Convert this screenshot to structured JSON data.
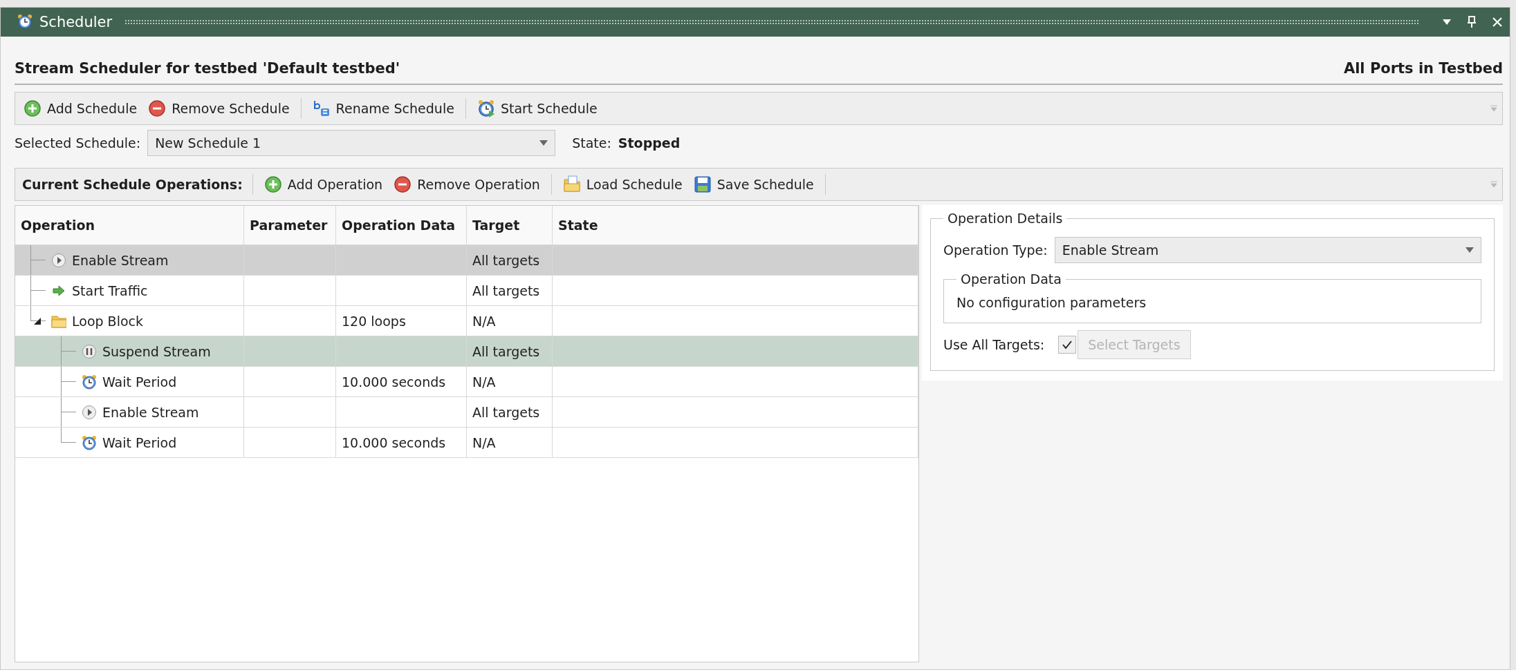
{
  "window": {
    "title": "Scheduler"
  },
  "header": {
    "title": "Stream Scheduler for testbed 'Default testbed'",
    "scope": "All Ports in Testbed"
  },
  "schedule_toolbar": {
    "groups": [
      [
        {
          "kind": "add",
          "label": "Add Schedule"
        },
        {
          "kind": "remove",
          "label": "Remove Schedule"
        }
      ],
      [
        {
          "kind": "rename",
          "label": "Rename Schedule"
        }
      ],
      [
        {
          "kind": "start",
          "label": "Start Schedule"
        }
      ]
    ]
  },
  "selected_schedule": {
    "label": "Selected Schedule:",
    "value": "New Schedule 1",
    "state_label": "State:",
    "state": "Stopped"
  },
  "operations_toolbar": {
    "label": "Current Schedule Operations:",
    "groups": [
      [
        {
          "kind": "add",
          "label": "Add Operation"
        },
        {
          "kind": "remove",
          "label": "Remove Operation"
        }
      ],
      [
        {
          "kind": "load",
          "label": "Load Schedule"
        },
        {
          "kind": "save",
          "label": "Save Schedule"
        }
      ]
    ]
  },
  "table": {
    "columns": [
      "Operation",
      "Parameter",
      "Operation Data",
      "Target",
      "State"
    ],
    "rows": [
      {
        "kind": "enable",
        "operation": "Enable Stream",
        "target": "All targets",
        "selected": true,
        "hovered": false
      },
      {
        "kind": "traffic",
        "operation": "Start Traffic",
        "target": "All targets",
        "selected": false,
        "hovered": false
      },
      {
        "kind": "loop",
        "operation": "Loop Block",
        "data": "120 loops",
        "target": "N/A",
        "selected": false,
        "hovered": false,
        "expanded": true,
        "children": [
          {
            "kind": "suspend",
            "operation": "Suspend Stream",
            "target": "All targets",
            "selected": false,
            "hovered": true
          },
          {
            "kind": "wait",
            "operation": "Wait Period",
            "data": "10.000 seconds",
            "target": "N/A",
            "selected": false,
            "hovered": false
          },
          {
            "kind": "enable",
            "operation": "Enable Stream",
            "target": "All targets",
            "selected": false,
            "hovered": false
          },
          {
            "kind": "wait",
            "operation": "Wait Period",
            "data": "10.000 seconds",
            "target": "N/A",
            "selected": false,
            "hovered": false
          }
        ]
      }
    ]
  },
  "details": {
    "title": "Operation Details",
    "type_label": "Operation Type:",
    "type_value": "Enable Stream",
    "data_title": "Operation Data",
    "data_text": "No configuration parameters",
    "targets_label": "Use All Targets:",
    "use_all_targets": true,
    "select_button": {
      "label": "Select Targets",
      "disabled": true
    }
  }
}
